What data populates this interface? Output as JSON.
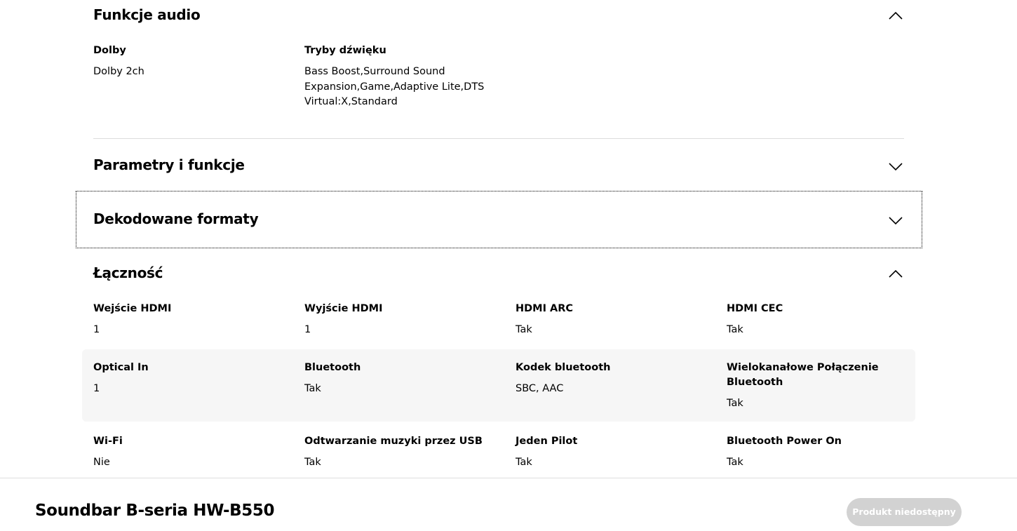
{
  "sections": {
    "audio": {
      "title": "Funkcje audio",
      "state": "expanded",
      "specs": [
        {
          "label": "Dolby",
          "value": "Dolby 2ch"
        },
        {
          "label": "Tryby dźwięku",
          "value_lines": [
            "Bass Boost,Surround Sound",
            "Expansion,Game,Adaptive Lite,DTS",
            "Virtual:X,Standard"
          ]
        }
      ]
    },
    "params": {
      "title": "Parametry i funkcje",
      "state": "collapsed"
    },
    "formats": {
      "title": "Dekodowane formaty",
      "state": "collapsed"
    },
    "connectivity": {
      "title": "Łączność",
      "state": "expanded",
      "rows": [
        [
          {
            "label": "Wejście HDMI",
            "value": "1"
          },
          {
            "label": "Wyjście HDMI",
            "value": "1"
          },
          {
            "label": "HDMI ARC",
            "value": "Tak"
          },
          {
            "label": "HDMI CEC",
            "value": "Tak"
          }
        ],
        [
          {
            "label": "Optical In",
            "value": "1"
          },
          {
            "label": "Bluetooth",
            "value": "Tak"
          },
          {
            "label": "Kodek bluetooth",
            "value": "SBC, AAC"
          },
          {
            "label_lines": [
              "Wielokanałowe Połączenie",
              "Bluetooth"
            ],
            "value": "Tak"
          }
        ],
        [
          {
            "label": "Wi-Fi",
            "value": "Nie"
          },
          {
            "label": "Odtwarzanie muzyki przez USB",
            "value": "Tak"
          },
          {
            "label": "Jeden Pilot",
            "value": "Tak"
          },
          {
            "label": "Bluetooth Power On",
            "value": "Tak"
          }
        ]
      ]
    }
  },
  "footer": {
    "product_name": "Soundbar B-seria HW-B550",
    "button_label": "Produkt niedostępny"
  },
  "icons": {
    "expanded": "chevron-up-icon",
    "collapsed": "chevron-down-icon"
  },
  "colors": {
    "row_band": "#f6f6f6",
    "button_bg": "#d2d2d2",
    "divider": "#dcdcdc"
  }
}
